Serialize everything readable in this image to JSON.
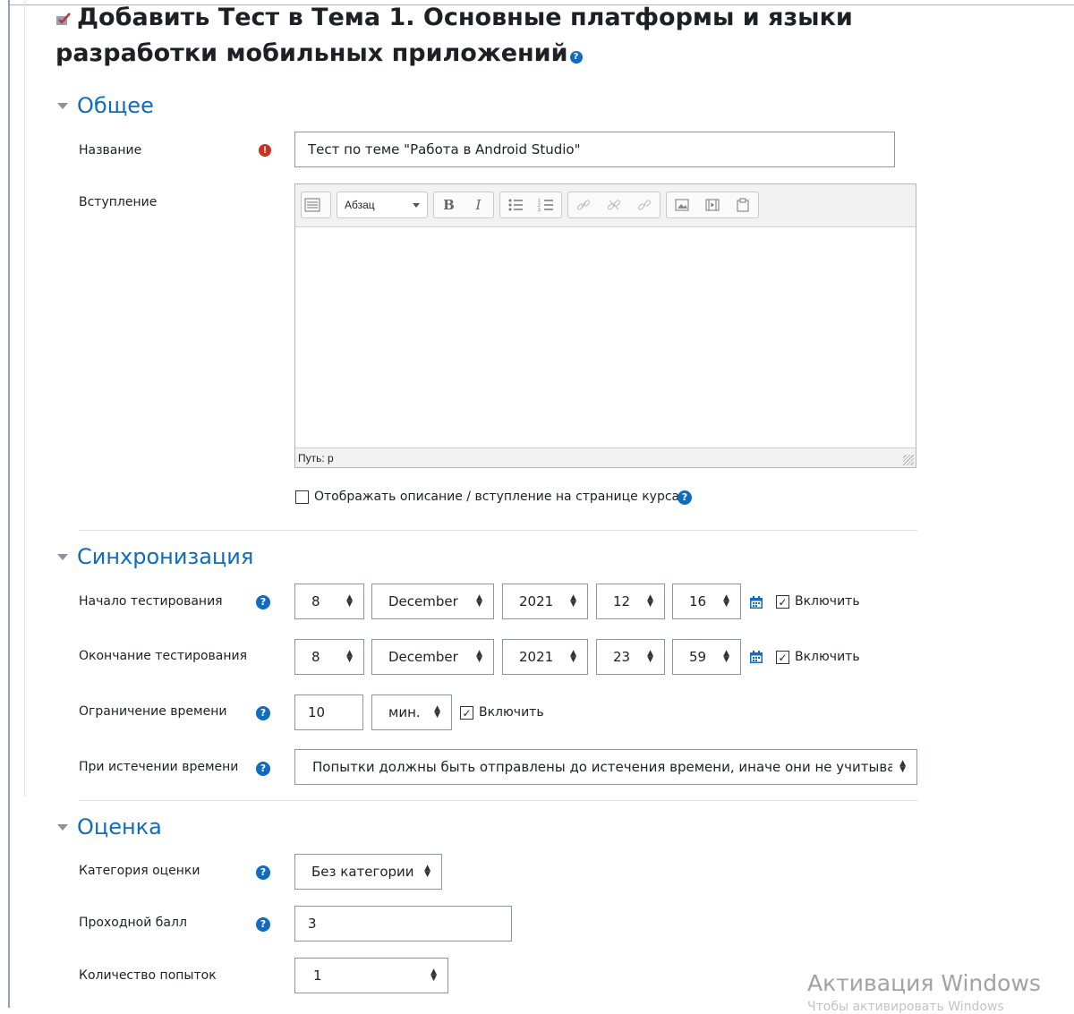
{
  "page": {
    "title": "Добавить Тест в Тема 1. Основные платформы и языки разработки мобильных приложений"
  },
  "colors": {
    "accent": "#0f6cbf",
    "required": "#ca3120",
    "text": "#1d2125"
  },
  "sections": {
    "general": {
      "title": "Общее",
      "name_label": "Название",
      "name_value": "Тест по теме \"Работа в  Android Studio\"",
      "intro_label": "Вступление",
      "editor": {
        "format_value": "Абзац",
        "bold": "B",
        "italic": "I",
        "status_path": "Путь: p"
      },
      "show_description_label": "Отображать описание / вступление на странице курса"
    },
    "timing": {
      "title": "Синхронизация",
      "open_label": "Начало тестирования",
      "open": {
        "day": "8",
        "month": "December",
        "year": "2021",
        "hour": "12",
        "minute": "16",
        "enable_label": "Включить"
      },
      "close_label": "Окончание тестирования",
      "close": {
        "day": "8",
        "month": "December",
        "year": "2021",
        "hour": "23",
        "minute": "59",
        "enable_label": "Включить"
      },
      "time_limit_label": "Ограничение времени",
      "time_limit_value": "10",
      "time_limit_unit": "мин.",
      "time_limit_enable_label": "Включить",
      "overdue_label": "При истечении времени",
      "overdue_value": "Попытки должны быть отправлены до истечения времени, иначе они не учитываются"
    },
    "grade": {
      "title": "Оценка",
      "category_label": "Категория оценки",
      "category_value": "Без категории",
      "pass_label": "Проходной балл",
      "pass_value": "3",
      "attempts_label": "Количество попыток",
      "attempts_value": "1"
    }
  },
  "watermark": {
    "title": "Активация Windows",
    "subtitle": "Чтобы активировать Windows"
  },
  "icons": {
    "title": "quiz-icon",
    "help": "question-circle-icon",
    "required": "exclamation-circle-icon",
    "calendar": "calendar-icon",
    "section_toggle": "caret-down-icon"
  }
}
